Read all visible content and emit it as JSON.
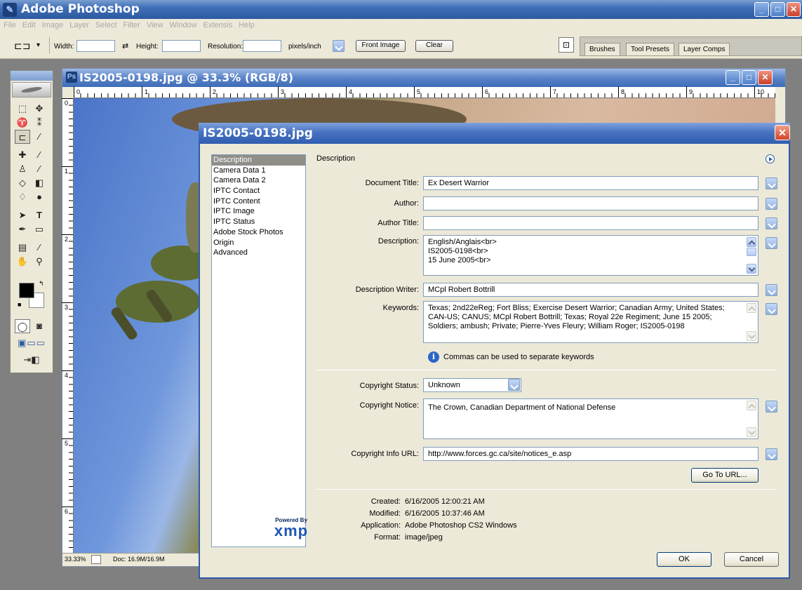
{
  "app": {
    "title": "Adobe Photoshop",
    "menu": [
      "File",
      "Edit",
      "Image",
      "Layer",
      "Select",
      "Filter",
      "View",
      "Window",
      "Extensis",
      "Help"
    ]
  },
  "options": {
    "width_label": "Width:",
    "height_label": "Height:",
    "resolution_label": "Resolution:",
    "units": "pixels/inch",
    "front_image": "Front Image",
    "clear": "Clear",
    "palette_tabs": [
      "Brushes",
      "Tool Presets",
      "Layer Comps"
    ]
  },
  "document": {
    "title": "IS2005-0198.jpg @ 33.3% (RGB/8)",
    "ruler_h": [
      "0",
      "1",
      "2",
      "3",
      "4",
      "5",
      "6",
      "7",
      "8",
      "9",
      "10"
    ],
    "ruler_v": [
      "0",
      "1",
      "2",
      "3",
      "4",
      "5",
      "6"
    ],
    "zoom": "33.33%",
    "doc_info": "Doc: 16.9M/16.9M"
  },
  "dialog": {
    "title": "IS2005-0198.jpg",
    "categories": [
      "Description",
      "Camera Data 1",
      "Camera Data 2",
      "IPTC Contact",
      "IPTC Content",
      "IPTC Image",
      "IPTC Status",
      "Adobe Stock Photos",
      "Origin",
      "Advanced"
    ],
    "section_title": "Description",
    "fields": {
      "document_title_label": "Document Title:",
      "document_title": "Ex Desert Warrior",
      "author_label": "Author:",
      "author": "",
      "author_title_label": "Author Title:",
      "author_title": "",
      "description_label": "Description:",
      "description_lines": [
        "English/Anglais<br>",
        "IS2005-0198<br>",
        "15 June 2005<br>"
      ],
      "description_writer_label": "Description Writer:",
      "description_writer": "MCpl Robert Bottrill",
      "keywords_label": "Keywords:",
      "keywords": "Texas; 2nd22eReg; Fort Bliss; Exercise Desert Warrior; Canadian Army; United States; CAN-US; CANUS; MCpl Robert Bottrill; Texas; Royal 22e Regiment; June 15 2005; Soldiers; ambush; Private; Pierre-Yves Fleury; William Roger; IS2005-0198",
      "keywords_hint": "Commas can be used to separate keywords",
      "copyright_status_label": "Copyright Status:",
      "copyright_status": "Unknown",
      "copyright_notice_label": "Copyright Notice:",
      "copyright_notice": "The Crown, Canadian Department of National Defense",
      "copyright_url_label": "Copyright Info URL:",
      "copyright_url": "http://www.forces.gc.ca/site/notices_e.asp",
      "go_to_url": "Go To URL..."
    },
    "meta": {
      "created_label": "Created:",
      "created": "6/16/2005 12:00:21 AM",
      "modified_label": "Modified:",
      "modified": "6/16/2005 10:37:46 AM",
      "application_label": "Application:",
      "application": "Adobe Photoshop CS2 Windows",
      "format_label": "Format:",
      "format": "image/jpeg"
    },
    "xmp": {
      "powered_by": "Powered By",
      "logo": "xmp"
    },
    "ok": "OK",
    "cancel": "Cancel"
  }
}
